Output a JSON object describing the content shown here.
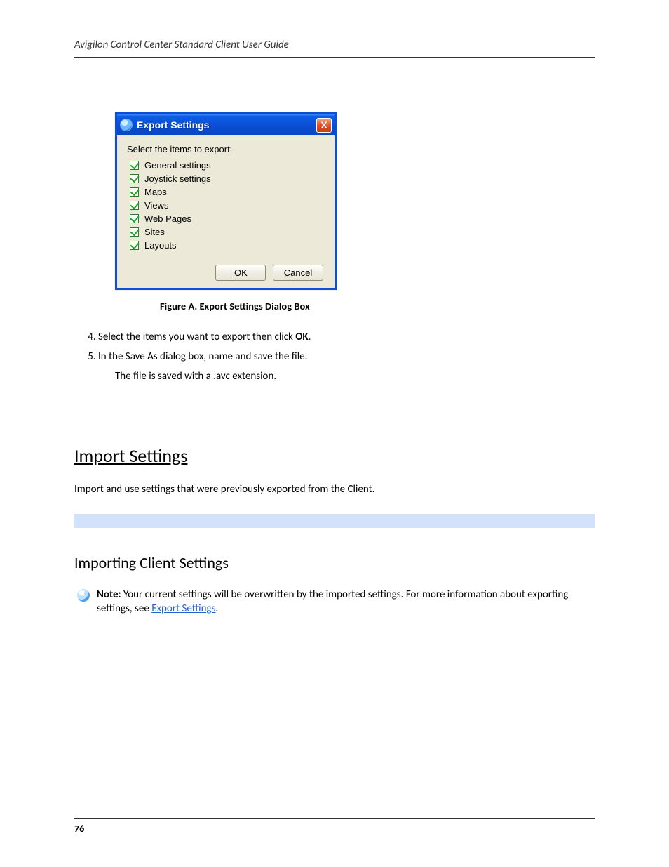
{
  "header": "Avigilon Control Center Standard Client User Guide",
  "dialog": {
    "title": "Export Settings",
    "close_glyph": "X",
    "instruction": "Select the items to export:",
    "items": [
      "General settings",
      "Joystick settings",
      "Maps",
      "Views",
      "Web Pages",
      "Sites",
      "Layouts"
    ],
    "ok_pre": "O",
    "ok_post": "K",
    "cancel_pre": "C",
    "cancel_post": "ancel"
  },
  "figure_caption": "Figure A.   Export Settings Dialog Box",
  "steps_after_figure": [
    {
      "n": "4",
      "text_a": "Select the items you want to export then click ",
      "btn": "OK",
      "text_b": "."
    },
    {
      "n": "5",
      "text_a": "In the Save As dialog box, name and save the file.",
      "btn": "",
      "text_b": ""
    }
  ],
  "export_note": "The file is saved with a .avc extension.",
  "h1": "Import Settings",
  "body_under_h1": "Import and use settings that were previously exported from the Client.",
  "h2": "Importing Client Settings",
  "note": {
    "label": "Note:",
    "before_link": " Your current settings will be overwritten by the imported settings. For more information about exporting settings, see ",
    "link": "Export Settings",
    "after_link": "."
  },
  "page_number": "76"
}
